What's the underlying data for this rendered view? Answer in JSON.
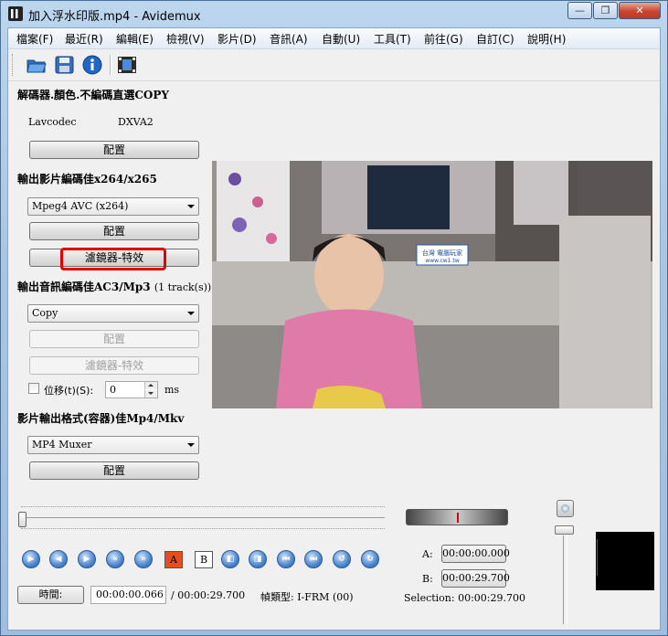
{
  "window": {
    "title": "加入浮水印版.mp4 - Avidemux",
    "minimize": "—",
    "maximize": "❐",
    "close": "✕"
  },
  "menu": [
    "檔案(F)",
    "最近(R)",
    "編輯(E)",
    "檢視(V)",
    "影片(D)",
    "音訊(A)",
    "自動(U)",
    "工具(T)",
    "前往(G)",
    "自訂(C)",
    "說明(H)"
  ],
  "toolbar_icons": [
    "open-folder-icon",
    "save-floppy-icon",
    "info-icon",
    "video-properties-icon"
  ],
  "decoder": {
    "heading": "解碼器.顏色.不編碼直選COPY",
    "lib": "Lavcodec",
    "hw": "DXVA2",
    "config_label": "配置"
  },
  "video_output": {
    "heading": "輸出影片編碼佳x264/x265",
    "codec": "Mpeg4 AVC (x264)",
    "config_label": "配置",
    "filters_label": "濾鏡器-特效"
  },
  "audio_output": {
    "heading": "輸出音訊編碼佳AC3/Mp3",
    "tracks": "(1 track(s))",
    "codec": "Copy",
    "config_label": "配置",
    "filters_label": "濾鏡器-特效",
    "shift_label": "位移(t)(S):",
    "shift_value": "0",
    "shift_unit": "ms"
  },
  "container": {
    "heading": "影片輸出格式(容器)佳Mp4/Mkv",
    "muxer": "MP4 Muxer",
    "config_label": "配置"
  },
  "watermark": {
    "text": "台灣 電腦玩家\nwww.cw1.tw"
  },
  "ab_markers": {
    "a": "A",
    "b": "B"
  },
  "selection": {
    "a_label": "A:",
    "a_time": "00:00:00.000",
    "b_label": "B:",
    "b_time": "00:00:29.700",
    "selection_label": "Selection: 00:00:29.700"
  },
  "status": {
    "time_button": "時間:",
    "current_time": "00:00:00.066",
    "total_time": "/ 00:00:29.700",
    "frame_type": "幀類型:  I-FRM (00)"
  },
  "colors": {
    "highlight": "#e00000",
    "marker_a": "#ea4b1f"
  }
}
